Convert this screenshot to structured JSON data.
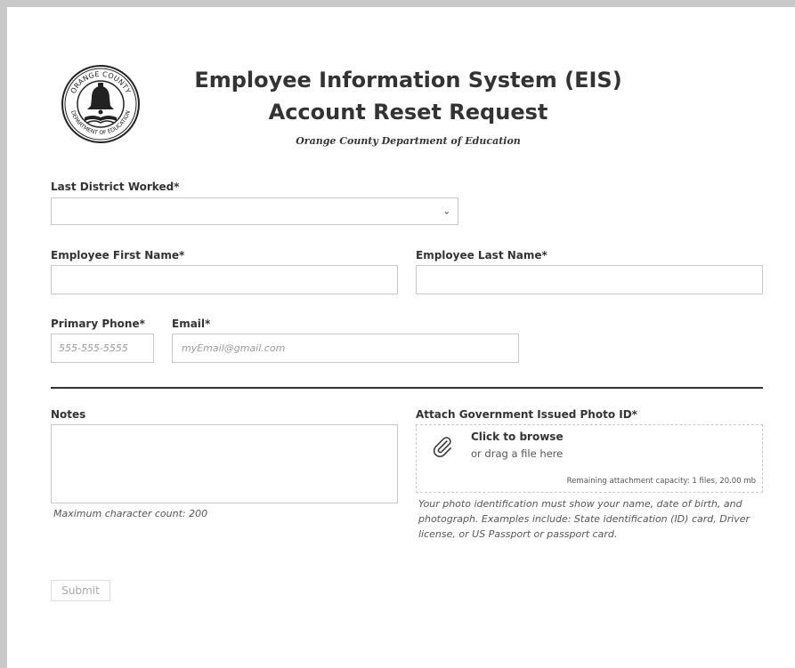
{
  "header": {
    "seal": {
      "top_text": "ORANGE COUNTY",
      "bottom_text": "DEPARTMENT OF EDUCATION"
    },
    "title_line1": "Employee Information System (EIS)",
    "title_line2": "Account Reset Request",
    "subtitle": "Orange County Department of Education"
  },
  "form": {
    "district": {
      "label": "Last District Worked*",
      "value": ""
    },
    "first_name": {
      "label": "Employee First Name*",
      "value": ""
    },
    "last_name": {
      "label": "Employee Last Name*",
      "value": ""
    },
    "phone": {
      "label": "Primary Phone*",
      "placeholder": "555-555-5555"
    },
    "email": {
      "label": "Email*",
      "placeholder": "myEmail@gmail.com"
    },
    "notes": {
      "label": "Notes",
      "hint": "Maximum character count: 200"
    },
    "attachment": {
      "label": "Attach Government Issued Photo ID*",
      "browse_text": "Click to browse",
      "drag_text": "or drag a file here",
      "capacity_text": "Remaining attachment capacity: 1 files, 20.00 mb",
      "id_note": "Your photo identification must show your name, date of birth, and photograph. Examples include: State identification (ID) card, Driver license, or US Passport or passport card."
    },
    "submit_label": "Submit"
  }
}
